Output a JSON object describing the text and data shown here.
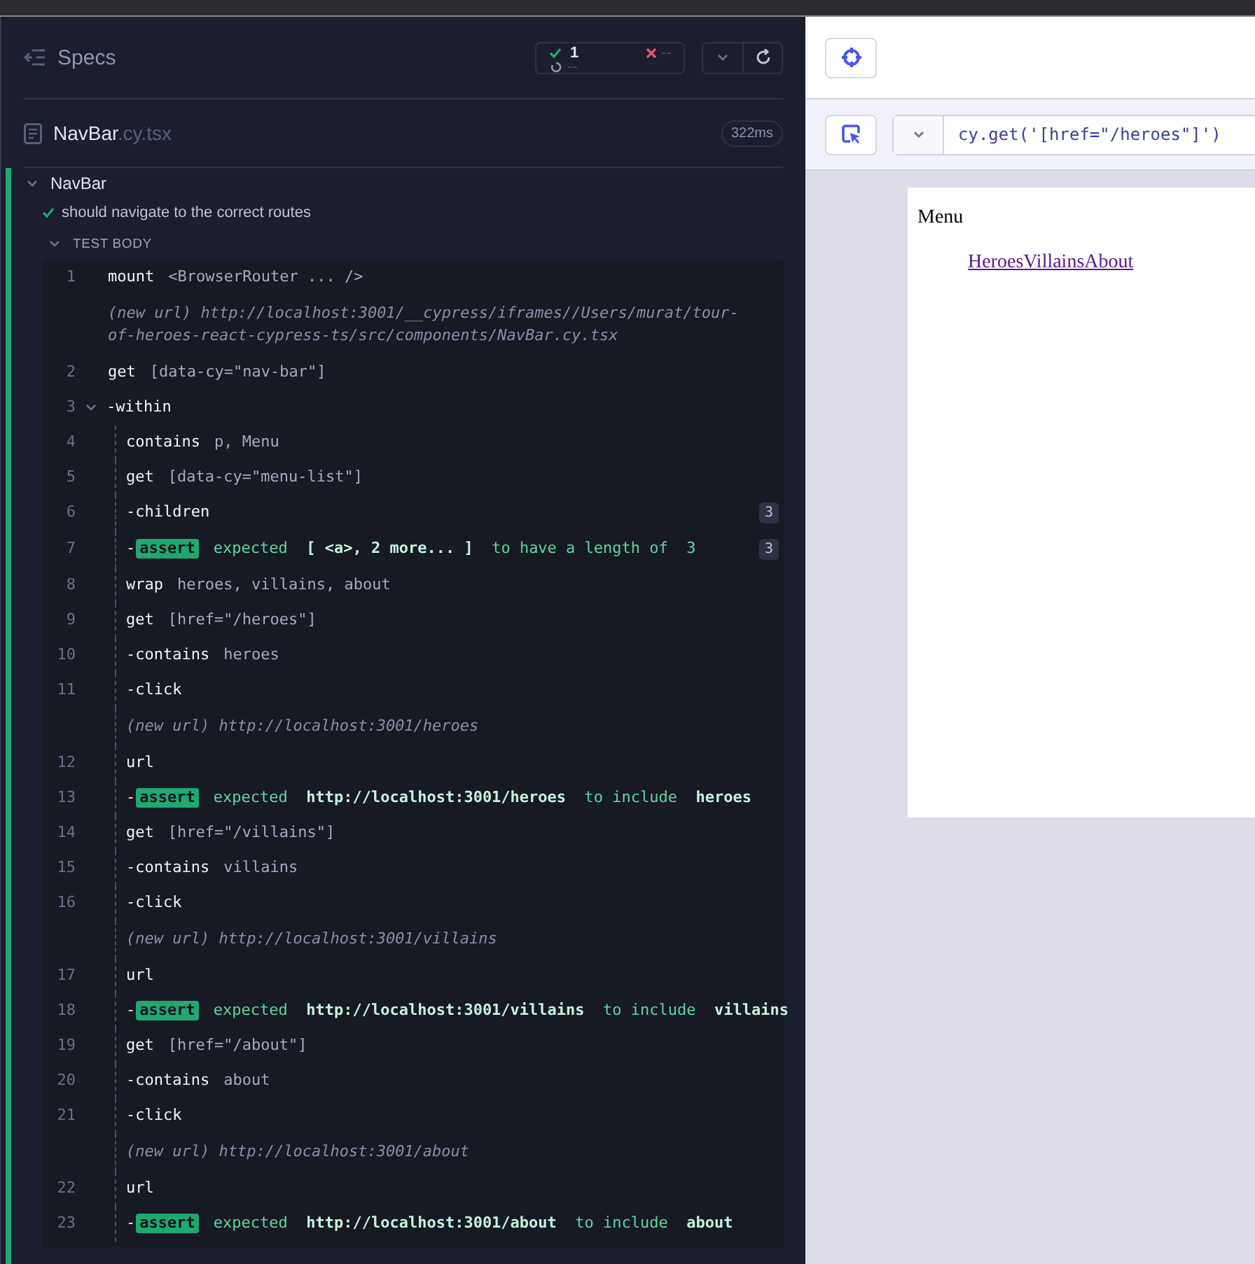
{
  "reporter": {
    "title": "Specs",
    "stats": {
      "passed": "1",
      "failed": "--",
      "pending": "--"
    },
    "spec": {
      "name": "NavBar",
      "extension": ".cy.tsx",
      "duration": "322ms"
    },
    "suite": {
      "title": "NavBar",
      "expanded": true,
      "test": {
        "title": "should navigate to the correct routes",
        "passed": true
      },
      "section": {
        "title": "TEST BODY",
        "expanded": true
      },
      "commands": [
        {
          "kind": "command",
          "number": "1",
          "name": "mount",
          "message": "<BrowserRouter ... />"
        },
        {
          "kind": "new_url",
          "label": "(new url)",
          "url": "http://localhost:3001/__cypress/iframes//Users/murat/tour-of-heroes-react-cypress-ts/src/components/NavBar.cy.tsx"
        },
        {
          "kind": "command",
          "number": "2",
          "name": "get",
          "message": "[data-cy=\"nav-bar\"]"
        },
        {
          "kind": "command",
          "number": "3",
          "name": "-within",
          "expanded": true,
          "children": [
            {
              "kind": "command",
              "number": "4",
              "name": "contains",
              "message": "p, Menu"
            },
            {
              "kind": "command",
              "number": "5",
              "name": "get",
              "message": "[data-cy=\"menu-list\"]"
            },
            {
              "kind": "command",
              "number": "6",
              "name": "-children",
              "count": "3"
            },
            {
              "kind": "assert",
              "number": "7",
              "prefix": "-",
              "label": "assert",
              "message": "expected  **[ <a>, 2 more... ]**  to have a length of  3",
              "count": "3"
            },
            {
              "kind": "command",
              "number": "8",
              "name": "wrap",
              "message": "heroes, villains, about"
            },
            {
              "kind": "command",
              "number": "9",
              "name": "get",
              "message": "[href=\"/heroes\"]"
            },
            {
              "kind": "command",
              "number": "10",
              "name": "-contains",
              "message": "heroes"
            },
            {
              "kind": "command",
              "number": "11",
              "name": "-click"
            },
            {
              "kind": "new_url",
              "label": "(new url)",
              "url": "http://localhost:3001/heroes"
            },
            {
              "kind": "command",
              "number": "12",
              "name": "url"
            },
            {
              "kind": "assert",
              "number": "13",
              "prefix": "-",
              "label": "assert",
              "message": "expected  **http://localhost:3001/heroes**  to include  **heroes**"
            },
            {
              "kind": "command",
              "number": "14",
              "name": "get",
              "message": "[href=\"/villains\"]"
            },
            {
              "kind": "command",
              "number": "15",
              "name": "-contains",
              "message": "villains"
            },
            {
              "kind": "command",
              "number": "16",
              "name": "-click"
            },
            {
              "kind": "new_url",
              "label": "(new url)",
              "url": "http://localhost:3001/villains"
            },
            {
              "kind": "command",
              "number": "17",
              "name": "url"
            },
            {
              "kind": "assert",
              "number": "18",
              "prefix": "-",
              "label": "assert",
              "message": "expected  **http://localhost:3001/villains**  to include  **villains**"
            },
            {
              "kind": "command",
              "number": "19",
              "name": "get",
              "message": "[href=\"/about\"]"
            },
            {
              "kind": "command",
              "number": "20",
              "name": "-contains",
              "message": "about"
            },
            {
              "kind": "command",
              "number": "21",
              "name": "-click"
            },
            {
              "kind": "new_url",
              "label": "(new url)",
              "url": "http://localhost:3001/about"
            },
            {
              "kind": "command",
              "number": "22",
              "name": "url"
            },
            {
              "kind": "assert",
              "number": "23",
              "prefix": "-",
              "label": "assert",
              "message": "expected  **http://localhost:3001/about**  to include  **about**"
            }
          ]
        }
      ]
    }
  },
  "preview": {
    "selector": {
      "value": "cy.get('[href=\"/heroes\"]')"
    },
    "app": {
      "heading": "Menu",
      "links": [
        "Heroes",
        "Villains",
        "About"
      ]
    }
  }
}
